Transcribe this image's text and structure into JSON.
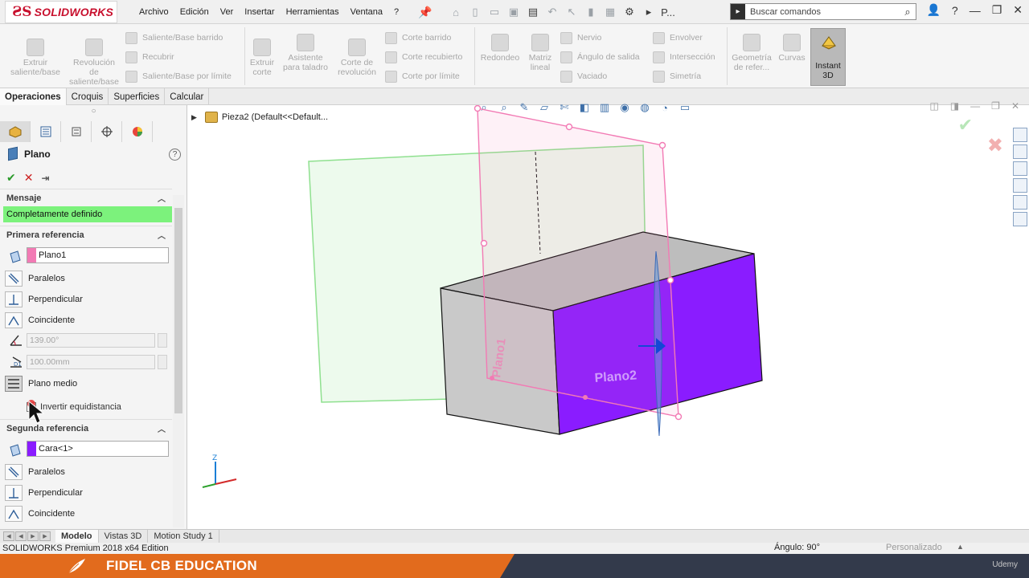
{
  "app": {
    "logo_text": "SOLIDWORKS",
    "menu": [
      "Archivo",
      "Edición",
      "Ver",
      "Insertar",
      "Herramientas",
      "Ventana",
      "?"
    ],
    "quick_access_cut": "P...",
    "search_placeholder": "Buscar comandos"
  },
  "ribbon": {
    "features": {
      "extrude_boss": "Extruir saliente/base",
      "revolve_boss": "Revolución de saliente/base",
      "swept_boss": "Saliente/Base barrido",
      "lofted_boss": "Recubrir",
      "boundary_boss": "Saliente/Base por límite",
      "extrude_cut": "Extruir corte",
      "hole_wizard": "Asistente para taladro",
      "revolve_cut": "Corte de revolución",
      "swept_cut": "Corte barrido",
      "lofted_cut": "Corte recubierto",
      "boundary_cut": "Corte por límite",
      "fillet": "Redondeo",
      "linear_pattern": "Matriz lineal",
      "rib": "Nervio",
      "draft": "Ángulo de salida",
      "shell": "Vaciado",
      "wrap": "Envolver",
      "intersect": "Intersección",
      "mirror": "Simetría",
      "ref_geometry": "Geometría de refer...",
      "curves": "Curvas",
      "instant3d": "Instant 3D"
    }
  },
  "tabs": [
    {
      "label": "Operaciones",
      "active": true
    },
    {
      "label": "Croquis",
      "active": false
    },
    {
      "label": "Superficies",
      "active": false
    },
    {
      "label": "Calcular",
      "active": false
    }
  ],
  "property_manager": {
    "title": "Plano",
    "help": "?",
    "message_header": "Mensaje",
    "message": "Completamente definido",
    "first_ref": {
      "header": "Primera referencia",
      "value": "Plano1",
      "color": "#f27ab4",
      "options": [
        "Paralelos",
        "Perpendicular",
        "Coincidente"
      ],
      "angle": "139.00°",
      "distance": "100.00mm",
      "mid_plane": "Plano medio",
      "flip_offset": "Invertir equidistancia"
    },
    "second_ref": {
      "header": "Segunda referencia",
      "value": "Cara<1>",
      "color": "#8a1cff",
      "options": [
        "Paralelos",
        "Perpendicular",
        "Coincidente"
      ]
    }
  },
  "viewport": {
    "tree_item": "Pieza2  (Default<<Default...",
    "label_plano1": "Plano1",
    "label_plano2": "Plano2",
    "axis_z": "Z"
  },
  "bottom_tabs": [
    {
      "label": "Modelo",
      "active": true
    },
    {
      "label": "Vistas 3D",
      "active": false
    },
    {
      "label": "Motion Study 1",
      "active": false
    }
  ],
  "status": {
    "edition": "SOLIDWORKS Premium 2018 x64 Edition",
    "angle": "Ángulo: 90°",
    "custom": "Personalizado"
  },
  "banner": {
    "text": "FIDEL CB EDUCATION",
    "watermark": "Udemy"
  },
  "colors": {
    "brand_red": "#c8102e",
    "message_green": "#7cf27c",
    "face_purple": "#8a1cff",
    "plane_pink": "#f27ab4",
    "plane_green": "#8fe08f",
    "banner_orange": "#e26b1d"
  }
}
